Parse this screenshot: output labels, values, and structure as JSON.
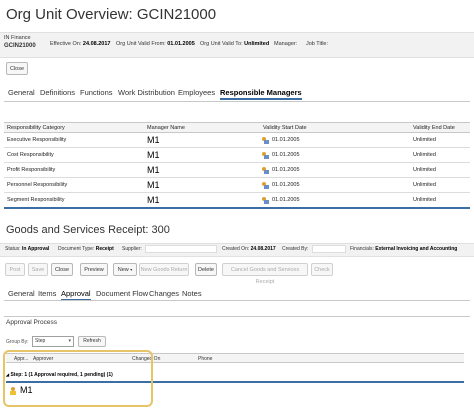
{
  "org": {
    "title": "Org Unit Overview: GCIN21000",
    "unit_line1": "IN Finance",
    "unit_line2": "GCIN21000",
    "effective_on_label": "Effective On:",
    "effective_on_value": "24.08.2017",
    "valid_from_label": "Org Unit Valid From:",
    "valid_from_value": "01.01.2005",
    "valid_to_label": "Org Unit Valid To:",
    "valid_to_value": "Unlimited",
    "manager_label": "Manager:",
    "job_title_label": "Job Title:",
    "close_label": "Close",
    "tabs": [
      "General",
      "Definitions",
      "Functions",
      "Work Distribution",
      "Employees",
      "Responsible Managers"
    ],
    "table_headers": [
      "Responsibility Category",
      "Manager Name",
      "Validity Start Date",
      "Validity End Date"
    ],
    "rows": [
      {
        "category": "Executive Responsibility",
        "manager": "M1",
        "start": "01.01.2005",
        "end": "Unlimited"
      },
      {
        "category": "Cost Responsibility",
        "manager": "M1",
        "start": "01.01.2005",
        "end": "Unlimited"
      },
      {
        "category": "Profit Responsibility",
        "manager": "M1",
        "start": "01.01.2005",
        "end": "Unlimited"
      },
      {
        "category": "Personnel Responsibility",
        "manager": "M1",
        "start": "01.01.2005",
        "end": "Unlimited"
      },
      {
        "category": "Segment Responsibility",
        "manager": "M1",
        "start": "01.01.2005",
        "end": "Unlimited"
      }
    ]
  },
  "gsr": {
    "title": "Goods and Services Receipt: 300",
    "status_label": "Status:",
    "status_value": "In Approval",
    "doc_type_label": "Document Type:",
    "doc_type_value": "Receipt",
    "supplier_label": "Supplier:",
    "created_on_label": "Created On:",
    "created_on_value": "24.08.2017",
    "created_by_label": "Created By:",
    "financials_label": "Financials:",
    "financials_value": "External Invoicing and Accounting",
    "buttons": {
      "post": "Post",
      "save": "Save",
      "close": "Close",
      "preview": "Preview",
      "new": "New",
      "new_goods_return": "New Goods Return",
      "delete": "Delete",
      "cancel_receipt": "Cancel Goods and Services Receipt",
      "check": "Check"
    },
    "tabs": [
      "General",
      "Items",
      "Approval",
      "Document Flow",
      "Changes",
      "Notes"
    ],
    "approval_process_label": "Approval Process",
    "group_by_label": "Group By:",
    "group_by_value": "Step",
    "refresh_label": "Refresh",
    "approval_headers": {
      "appr": "Appr...",
      "approver": "Approver",
      "changed_on": "Changed On",
      "phone": "Phone"
    },
    "step_row": "Step: 1 (1 Approval required, 1 pending) (1)",
    "approver_name": "M1"
  }
}
